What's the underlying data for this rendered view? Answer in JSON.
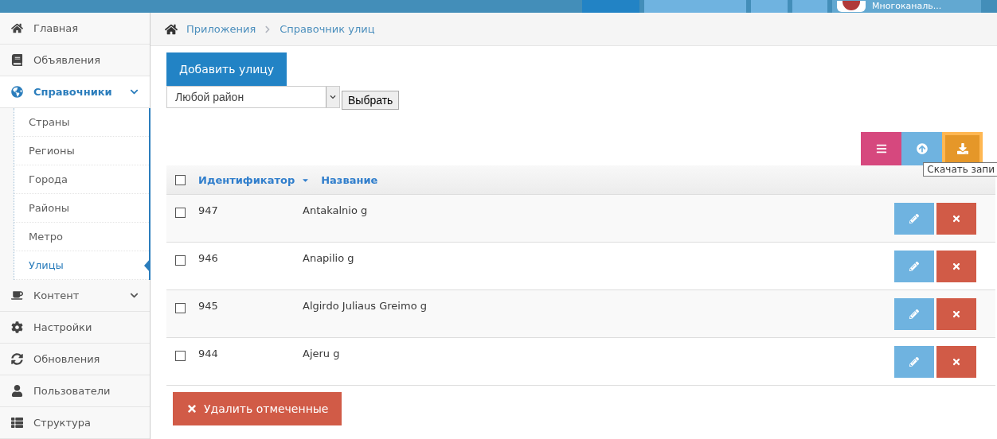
{
  "header": {
    "user_name": "Многоканаль..."
  },
  "sidebar": {
    "items": [
      {
        "label": "Главная",
        "kind": "link",
        "selected": false
      },
      {
        "label": "Объявления",
        "kind": "link",
        "selected": false
      },
      {
        "label": "Справочники",
        "kind": "group",
        "selected": true,
        "expanded": true,
        "children": [
          {
            "label": "Страны",
            "selected": false
          },
          {
            "label": "Регионы",
            "selected": false
          },
          {
            "label": "Города",
            "selected": false
          },
          {
            "label": "Районы",
            "selected": false
          },
          {
            "label": "Метро",
            "selected": false
          },
          {
            "label": "Улицы",
            "selected": true
          }
        ]
      },
      {
        "label": "Контент",
        "kind": "group",
        "selected": false
      },
      {
        "label": "Настройки",
        "kind": "link",
        "selected": false
      },
      {
        "label": "Обновления",
        "kind": "link",
        "selected": false
      },
      {
        "label": "Пользователи",
        "kind": "link",
        "selected": false
      },
      {
        "label": "Структура",
        "kind": "link",
        "selected": false
      }
    ]
  },
  "breadcrumbs": [
    "Приложения",
    "Справочник улиц"
  ],
  "add_button": "Добавить улицу",
  "filter": {
    "value": "Любой район",
    "button": "Выбрать"
  },
  "tooltip": "Скачать запи",
  "table": {
    "all_checked": false,
    "columns": [
      "Идентификатор",
      "Название"
    ],
    "rows": [
      {
        "id": "947",
        "name": "Antakalnio g",
        "checked": false
      },
      {
        "id": "946",
        "name": "Anapilio g",
        "checked": false
      },
      {
        "id": "945",
        "name": "Algirdo Juliaus Greimo g",
        "checked": false
      },
      {
        "id": "944",
        "name": "Ajeru g",
        "checked": false
      }
    ]
  },
  "delete_selected": "Удалить отмеченные"
}
